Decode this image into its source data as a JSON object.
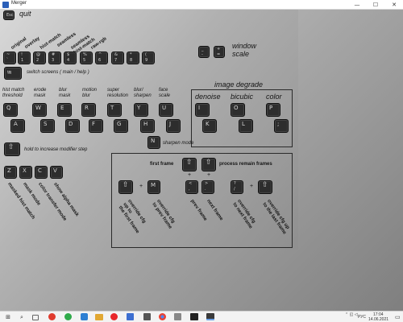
{
  "window": {
    "title": "Merger",
    "minimize": "—",
    "maximize": "☐",
    "close": "✕"
  },
  "quit": {
    "key": "Esc",
    "label": "quit"
  },
  "modes": {
    "labels": [
      "original",
      "overlay",
      "hist-match",
      "seamless",
      "seamless\nhist-match",
      "raw-rgb"
    ]
  },
  "num_keys": [
    {
      "top": "~",
      "bottom": "`"
    },
    {
      "top": "!",
      "bottom": "1"
    },
    {
      "top": "@",
      "bottom": "2"
    },
    {
      "top": "#",
      "bottom": "3"
    },
    {
      "top": "$",
      "bottom": "4"
    },
    {
      "top": "%",
      "bottom": "5"
    },
    {
      "top": "^",
      "bottom": "6"
    },
    {
      "top": "&",
      "bottom": "7"
    },
    {
      "top": "*",
      "bottom": "8"
    },
    {
      "top": "(",
      "bottom": "9"
    }
  ],
  "window_scale": {
    "label": "window\nscale",
    "keys": [
      {
        "top": "_",
        "bottom": "-"
      },
      {
        "top": "+",
        "bottom": "="
      }
    ]
  },
  "switch_screens": {
    "key": "⭾",
    "label": "switch screens ( main / help )"
  },
  "adjust": {
    "labels": [
      "hist match\nthreshold",
      "erode\nmask",
      "blur\nmask",
      "motion\nblur",
      "super\nresolution",
      "blur/\nsharpen",
      "face\nscale"
    ],
    "up_keys": [
      "Q",
      "W",
      "E",
      "R",
      "T",
      "Y",
      "U"
    ],
    "down_keys": [
      "A",
      "S",
      "D",
      "F",
      "G",
      "H",
      "J"
    ]
  },
  "image_degrade": {
    "title": "image degrade",
    "labels": [
      "denoise",
      "bicubic",
      "color"
    ],
    "up_keys": [
      "I",
      "O",
      "P"
    ],
    "down_keys": [
      "K",
      "L",
      ";"
    ]
  },
  "sharpen": {
    "key": "N",
    "label": "sharpen mode"
  },
  "modifier": {
    "key": "⇧",
    "label": "hold to increase modifier step"
  },
  "masks": {
    "keys": [
      "Z",
      "X",
      "C",
      "V"
    ],
    "labels": [
      "masked hist match",
      "mask mode",
      "color transfer mode",
      "show alpha mask"
    ]
  },
  "frames": {
    "first_frame_label": "first frame",
    "process_label": "process remain frames",
    "shift_up_1": "⇧",
    "shift_up_2": "⇧",
    "plus": "+",
    "key_shift_a": "⇧",
    "key_m": "M",
    "key_comma": {
      "top": "<",
      "bottom": ","
    },
    "key_period": {
      "top": ">",
      "bottom": "."
    },
    "key_slash": {
      "top": "?",
      "bottom": "/"
    },
    "key_shift_b": "⇧",
    "labels": [
      "override cfg\nup to\nthe first frame",
      "override cfg\nto prev frame",
      "prev frame",
      "next frame",
      "override cfg\nto next frame",
      "override cfg up\nto the last frame"
    ]
  },
  "taskbar": {
    "start": "⊞",
    "search": "⌕",
    "lang": "РУС",
    "time": "17:04",
    "date": "14.06.2021"
  }
}
